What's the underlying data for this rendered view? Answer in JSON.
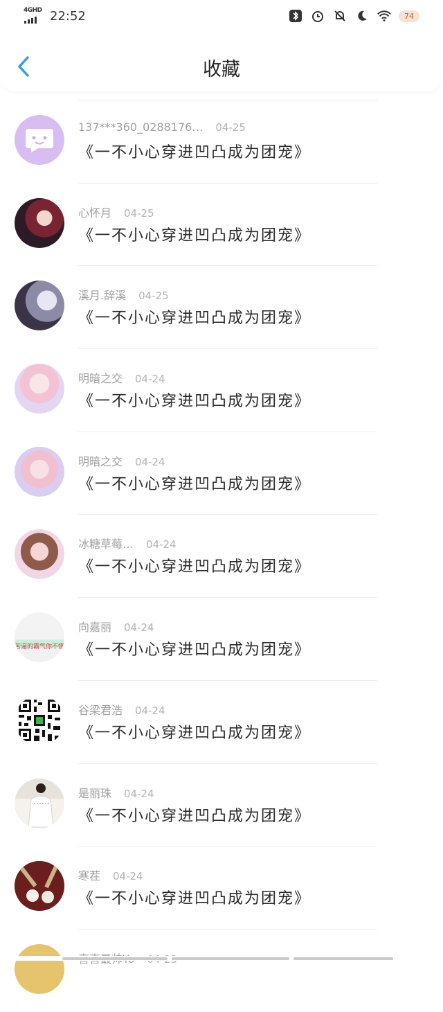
{
  "status_bar": {
    "network": "4GHD",
    "time": "22:52",
    "battery": "74",
    "icons": [
      "bluetooth-icon",
      "alarm-icon",
      "mute-icon",
      "moon-icon",
      "wifi-icon"
    ]
  },
  "header": {
    "back_icon": "chevron-left-icon",
    "title": "收藏"
  },
  "items": [
    {
      "name": "137***360_0288176…",
      "date": "04-25",
      "book": "《一不小心穿进凹凸成为团宠》"
    },
    {
      "name": "心怀月",
      "date": "04-25",
      "book": "《一不小心穿进凹凸成为团宠》"
    },
    {
      "name": "溪月.辞溪",
      "date": "04-25",
      "book": "《一不小心穿进凹凸成为团宠》"
    },
    {
      "name": "明暗之交",
      "date": "04-24",
      "book": "《一不小心穿进凹凸成为团宠》"
    },
    {
      "name": "明暗之交",
      "date": "04-24",
      "book": "《一不小心穿进凹凸成为团宠》"
    },
    {
      "name": "冰糖草莓…",
      "date": "04-24",
      "book": "《一不小心穿进凹凸成为团宠》"
    },
    {
      "name": "向嘉丽",
      "date": "04-24",
      "book": "《一不小心穿进凹凸成为团宠》"
    },
    {
      "name": "谷梁君浩",
      "date": "04-24",
      "book": "《一不小心穿进凹凸成为团宠》"
    },
    {
      "name": "是丽珠",
      "date": "04-24",
      "book": "《一不小心穿进凹凸成为团宠》"
    },
    {
      "name": "寒茬",
      "date": "04-24",
      "book": "《一不小心穿进凹凸成为团宠》"
    },
    {
      "name": "喜喜最帅Yo",
      "date": "04-23",
      "book": ""
    }
  ],
  "avatar_captions": {
    "item6": "苦逼的霸气你不懂"
  },
  "colors": {
    "accent": "#2f9bf0",
    "bubble_avatar": "#d8bdf3"
  }
}
